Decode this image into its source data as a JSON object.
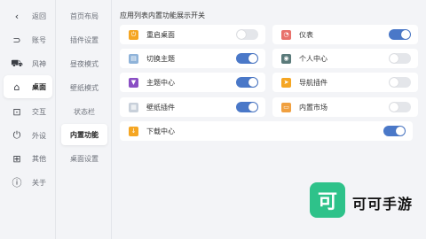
{
  "rail": {
    "items": [
      {
        "label": "返回",
        "icon": "chevron-left-icon",
        "glyph": "‹"
      },
      {
        "label": "账号",
        "icon": "account-icon",
        "glyph": "⊃"
      },
      {
        "label": "风神",
        "icon": "car-icon",
        "glyph": "⛟"
      },
      {
        "label": "桌面",
        "icon": "home-icon",
        "glyph": "⌂"
      },
      {
        "label": "交互",
        "icon": "interaction-icon",
        "glyph": "⊡"
      },
      {
        "label": "外设",
        "icon": "power-icon",
        "glyph": "⏻"
      },
      {
        "label": "其他",
        "icon": "grid-icon",
        "glyph": "⊞"
      },
      {
        "label": "关于",
        "icon": "info-icon",
        "glyph": "ⓘ"
      }
    ]
  },
  "subnav": {
    "items": [
      "首页布局",
      "插件设置",
      "昼夜模式",
      "壁纸模式",
      "状态栏",
      "内置功能",
      "桌面设置"
    ]
  },
  "main": {
    "heading": "应用列表内置功能展示开关",
    "cards": [
      {
        "label": "重启桌面",
        "icon": "restart-icon",
        "color": "#f5a623",
        "glyph": "⏻",
        "on": false
      },
      {
        "label": "仪表",
        "icon": "gauge-icon",
        "color": "#e8716b",
        "glyph": "◔",
        "on": true
      },
      {
        "label": "切换主题",
        "icon": "theme-switch-icon",
        "color": "#8fb3d9",
        "glyph": "▤",
        "on": true
      },
      {
        "label": "个人中心",
        "icon": "profile-icon",
        "color": "#5a7a7a",
        "glyph": "◉",
        "on": false
      },
      {
        "label": "主题中心",
        "icon": "theme-center-icon",
        "color": "#8a4fc4",
        "glyph": "▼",
        "on": true
      },
      {
        "label": "导航插件",
        "icon": "navigation-icon",
        "color": "#f5a623",
        "glyph": "➤",
        "on": false
      },
      {
        "label": "壁纸插件",
        "icon": "wallpaper-icon",
        "color": "#c8d0da",
        "glyph": "▦",
        "on": true
      },
      {
        "label": "内置市场",
        "icon": "market-icon",
        "color": "#f0a040",
        "glyph": "▭",
        "on": false
      },
      {
        "label": "下载中心",
        "icon": "download-icon",
        "color": "#f5a623",
        "glyph": "↓",
        "on": true
      }
    ]
  },
  "watermark": {
    "logo_glyph": "可",
    "text": "可可手游"
  }
}
